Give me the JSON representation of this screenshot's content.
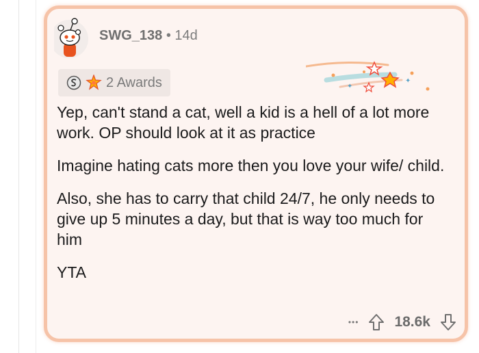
{
  "comment": {
    "username": "SWG_138",
    "separator": "•",
    "age": "14d",
    "awards_label": "2 Awards",
    "paragraphs": [
      "Yep, can't stand a cat, well a kid is a hell of a lot more work.  OP should look at it as practice",
      "Imagine hating cats more then you love your wife/ child.",
      "Also, she has to carry that child 24/7, he only needs to give up 5 minutes a day, but that is way too much for him",
      "YTA"
    ],
    "more_label": "•••",
    "score": "18.6k"
  },
  "colors": {
    "border": "#f6c3a8",
    "card_bg": "#fdf4f1",
    "avatar_orange": "#e8531f"
  },
  "icons": [
    "avatar",
    "silver-award-icon",
    "gold-award-icon",
    "award-comet-decoration",
    "more-icon",
    "upvote-icon",
    "downvote-icon"
  ]
}
